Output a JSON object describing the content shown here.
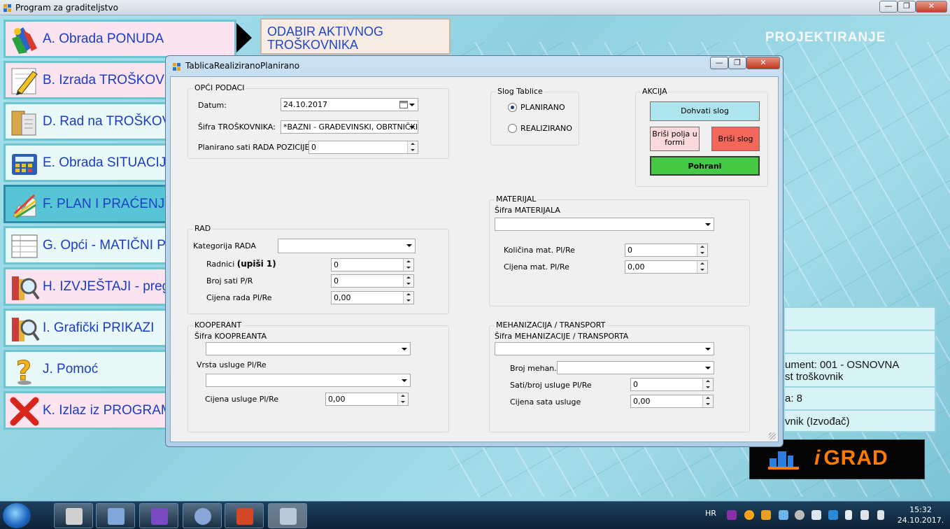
{
  "app": {
    "title": "Program za graditeljstvo",
    "section": "PROJEKTIRANJE",
    "brand": "GRAD",
    "brand_prefix": "i"
  },
  "window_buttons": {
    "minimize": "—",
    "restore": "❐",
    "close": "✕"
  },
  "menu": [
    {
      "label": "A. Obrada PONUDA"
    },
    {
      "label": "B. Izrada TROŠKOVNIKA"
    },
    {
      "label": "D. Rad na TROŠKOVNIKU"
    },
    {
      "label": "E. Obrada SITUACIJA"
    },
    {
      "label": "F. PLAN I PRAĆENJE"
    },
    {
      "label": "G. Opći - MATIČNI PODACI"
    },
    {
      "label": "H. IZVJEŠTAJI - pregled"
    },
    {
      "label": "I. Grafički PRIKAZI"
    },
    {
      "label": "J. Pomoć"
    },
    {
      "label": "K. Izlaz iz PROGRAMA"
    }
  ],
  "odabir": {
    "line1": "ODABIR AKTIVNOG",
    "line2": "TROŠKOVNIKA"
  },
  "info_panel": {
    "dokument_l1": "ument: 001 - OSNOVNA",
    "dokument_l2": "st troškovnik",
    "stavka": "a: 8",
    "vlasnik": "vnik (Izvođač)"
  },
  "dialog": {
    "title": "TablicaRealiziranoPlanirano",
    "opci": {
      "title": "OPĆI PODACI",
      "datum_label": "Datum:",
      "datum_value": "24.10.2017",
      "sifra_label": "Šifra TROŠKOVNIKA:",
      "sifra_value": "*BAZNI - GRAĐEVINSKI, OBRTNIČKI",
      "planirano_label": "Planirano sati RADA POZICIJE",
      "planirano_value": "0"
    },
    "slog": {
      "title": "Slog Tablice",
      "opt1": "PLANIRANO",
      "opt2": "REALIZIRANO",
      "selected": "PLANIRANO"
    },
    "akcija": {
      "title": "AKCIJA",
      "dohvati": "Dohvati slog",
      "brisi_polja": "Briši polja u formi",
      "brisi_slog": "Briši slog",
      "pohrani": "Pohrani"
    },
    "materijal": {
      "title": "MATERIJAL",
      "sifra_label": "Šifra MATERIJALA",
      "sifra_value": "",
      "kolicina_label": "Količina mat. Pl/Re",
      "kolicina_value": "0",
      "cijena_label": "Cijena mat. Pl/Re",
      "cijena_value": "0,00"
    },
    "rad": {
      "title": "RAD",
      "kategorija_label": "Kategorija RADA",
      "kategorija_value": "",
      "radnici_label": "Radnici",
      "radnici_hint": "(upiši 1)",
      "radnici_value": "0",
      "broj_sati_label": "Broj sati P/R",
      "broj_sati_value": "0",
      "cijena_label": "Cijena rada Pl/Re",
      "cijena_value": "0,00"
    },
    "kooperant": {
      "title": "KOOPERANT",
      "sifra_label": "Šifra KOOPREANTA",
      "sifra_value": "",
      "vrsta_label": "Vrsta usluge Pl/Re",
      "vrsta_value": "",
      "cijena_label": "Cijena usluge Pl/Re",
      "cijena_value": "0,00"
    },
    "mehanizacija": {
      "title": "MEHANIZACIJA / TRANSPORT",
      "sifra_label": "Šifra MEHANIZACIJE / TRANSPORTA",
      "sifra_value": "",
      "broj_label": "Broj mehan.",
      "broj_value": "",
      "sati_label": "Sati/broj usluge Pl/Re",
      "sati_value": "0",
      "cijena_label": "Cijena sata usluge",
      "cijena_value": "0,00"
    }
  },
  "taskbar": {
    "lang": "HR",
    "time": "15:32",
    "date": "24.10.2017."
  }
}
